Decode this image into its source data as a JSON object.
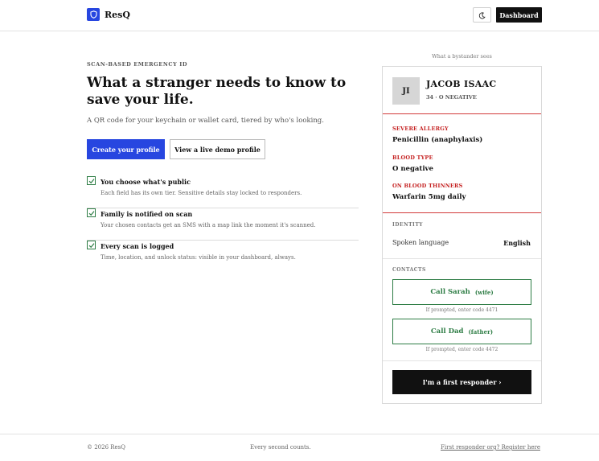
{
  "header": {
    "brand": "ResQ",
    "theme_icon": "moon-icon",
    "dashboard_label": "Dashboard"
  },
  "hero": {
    "eyebrow": "SCAN-BASED EMERGENCY ID",
    "headline": "What a stranger needs to know to save your life.",
    "subline": "A QR code for your keychain or wallet card, tiered by who's looking.",
    "primary_cta": "Create your profile",
    "secondary_cta": "View a live demo profile"
  },
  "features": [
    {
      "title": "You choose what's public",
      "desc": "Each field has its own tier. Sensitive details stay locked to responders."
    },
    {
      "title": "Family is notified on scan",
      "desc": "Your chosen contacts get an SMS with a map link the moment it's scanned."
    },
    {
      "title": "Every scan is logged",
      "desc": "Time, location, and unlock status: visible in your dashboard, always."
    }
  ],
  "card": {
    "caption": "What a bystander sees",
    "initials": "JI",
    "name": "JACOB ISAAC",
    "meta": "34 · O NEGATIVE",
    "critical": [
      {
        "label": "SEVERE ALLERGY",
        "value": "Penicillin (anaphylaxis)"
      },
      {
        "label": "BLOOD TYPE",
        "value": "O negative"
      },
      {
        "label": "ON BLOOD THINNERS",
        "value": "Warfarin 5mg daily"
      }
    ],
    "identity_label": "IDENTITY",
    "identity_key": "Spoken language",
    "identity_value": "English",
    "contacts_label": "CONTACTS",
    "contacts": [
      {
        "name": "Call Sarah",
        "relation": "(wife)",
        "hint": "If prompted, enter code 4471"
      },
      {
        "name": "Call Dad",
        "relation": "(father)",
        "hint": "If prompted, enter code 4472"
      }
    ],
    "responder_cta": "I'm a first responder ›"
  },
  "footer": {
    "copyright": "© 2026 ResQ",
    "tagline": "Every second counts.",
    "link": "First responder org? Register here"
  },
  "colors": {
    "accent": "#2746e0",
    "critical": "#c52222",
    "contact": "#2e7d45"
  }
}
